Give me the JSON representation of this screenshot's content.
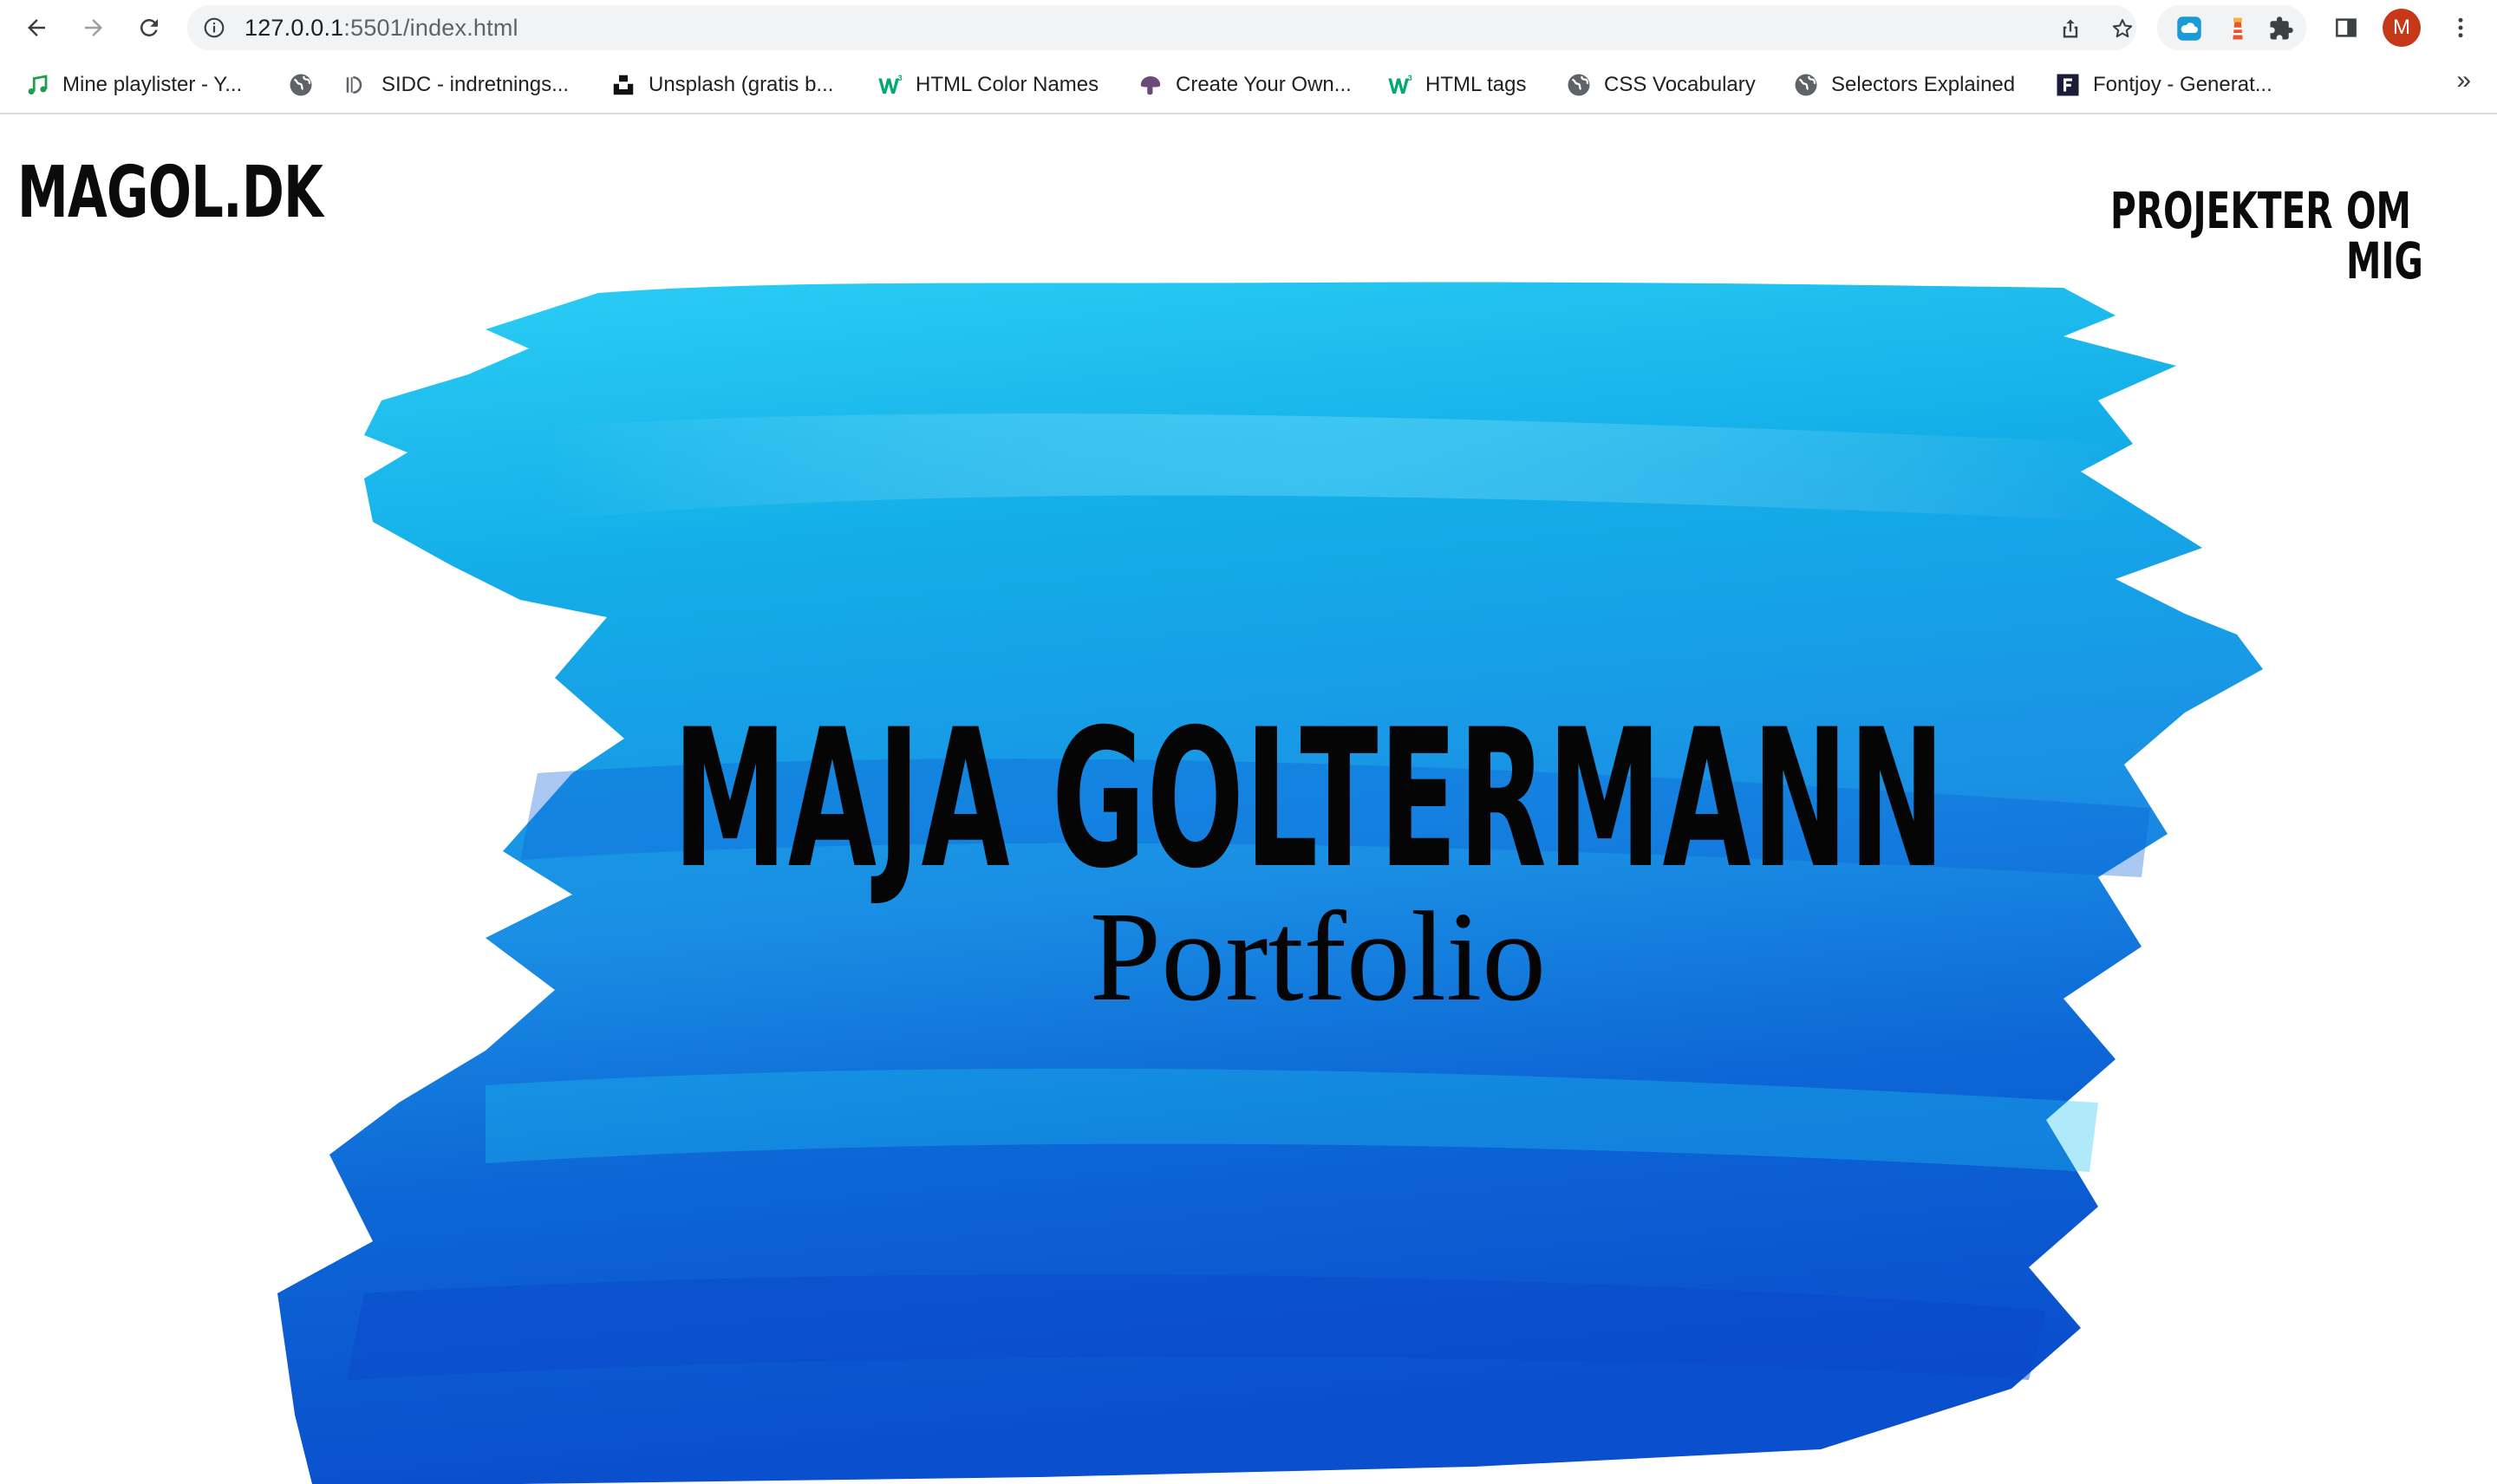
{
  "browser": {
    "url_host": "127.0.0.1",
    "url_path": ":5501/index.html",
    "profile_initial": "M"
  },
  "bookmarks": [
    {
      "label": "Mine playlister - Y...",
      "icon": "music-note-icon"
    },
    {
      "label": "",
      "icon": "globe-icon"
    },
    {
      "label": "SIDC - indretnings...",
      "icon": "sidc-icon"
    },
    {
      "label": "Unsplash (gratis b...",
      "icon": "unsplash-icon"
    },
    {
      "label": "HTML Color Names",
      "icon": "w3schools-icon"
    },
    {
      "label": "Create Your Own...",
      "icon": "mushroom-icon"
    },
    {
      "label": "HTML tags",
      "icon": "w3schools-icon"
    },
    {
      "label": "CSS Vocabulary",
      "icon": "globe-icon"
    },
    {
      "label": "Selectors Explained",
      "icon": "globe-icon"
    },
    {
      "label": "Fontjoy - Generat...",
      "icon": "fontjoy-icon"
    }
  ],
  "bookmarks_more": "»",
  "site": {
    "logo": "MAGOL.DK",
    "nav": [
      "PROJEKTER",
      "OM MIG"
    ],
    "hero_title": "MAJA GOLTERMANN",
    "hero_subtitle": "Portfolio"
  },
  "colors": {
    "paint_light": "#1ec3f0",
    "paint_mid": "#12a2e6",
    "paint_deep": "#0a56d2",
    "avatar": "#c5381a"
  }
}
